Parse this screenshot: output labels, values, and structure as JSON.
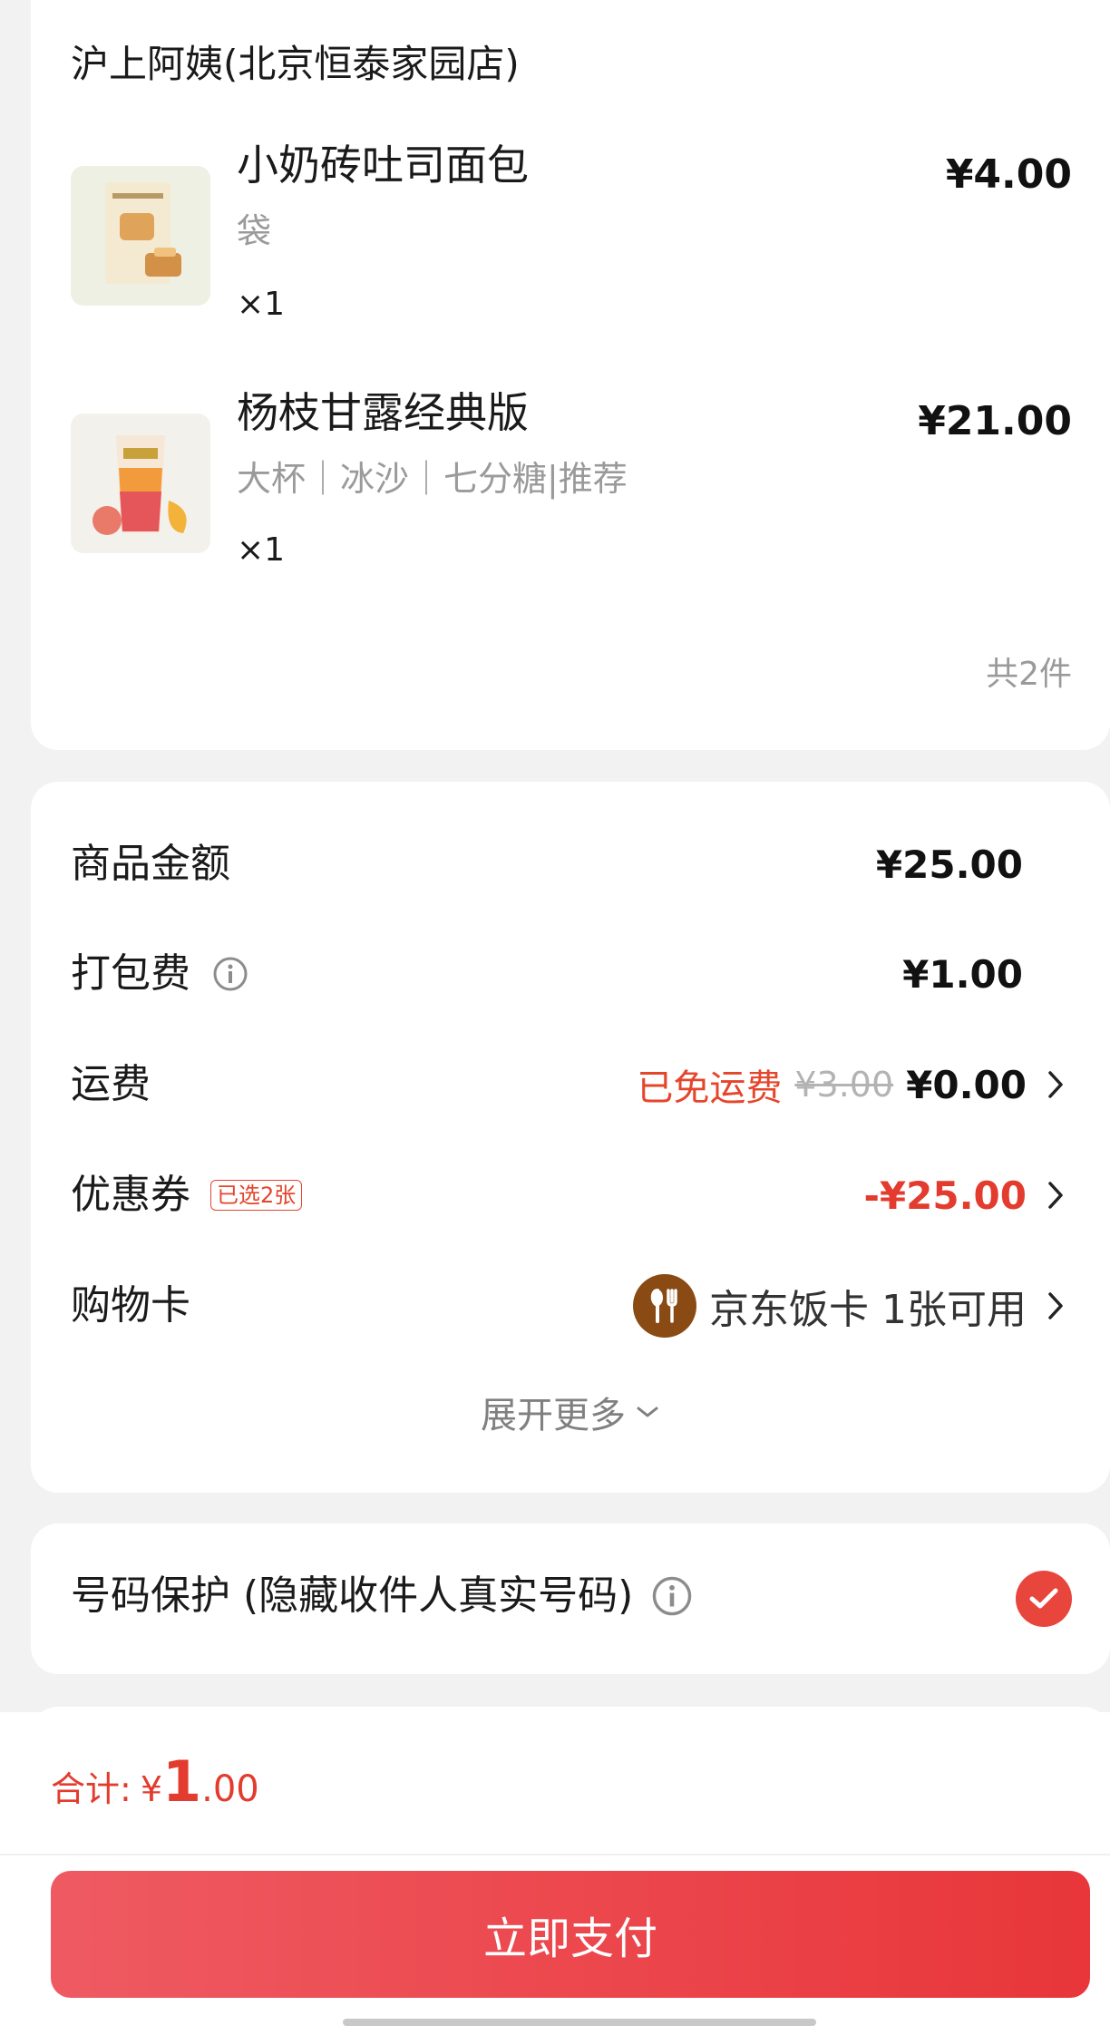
{
  "store": {
    "name": "沪上阿姨(北京恒泰家园店)",
    "items": [
      {
        "title": "小奶砖吐司面包",
        "spec": "袋",
        "qty": "×1",
        "price": "¥4.00"
      },
      {
        "title": "杨枝甘露经典版",
        "spec": "大杯｜冰沙｜七分糖|推荐",
        "qty": "×1",
        "price": "¥21.00"
      }
    ],
    "count": "共2件"
  },
  "fees": {
    "goods": {
      "label": "商品金额",
      "value": "¥25.00"
    },
    "packing": {
      "label": "打包费",
      "value": "¥1.00"
    },
    "shipping": {
      "label": "运费",
      "free_text": "已免运费",
      "original": "¥3.00",
      "value": "¥0.00"
    },
    "coupon": {
      "label": "优惠券",
      "badge": "已选2张",
      "value": "-¥25.00"
    },
    "shopping_card": {
      "label": "购物卡",
      "card_name": "京东饭卡",
      "available": "1张可用"
    },
    "expand_more": "展开更多"
  },
  "privacy": {
    "label": "号码保护 (隐藏收件人真实号码)",
    "checked": true
  },
  "bottom": {
    "total_label": "合计:",
    "currency": "¥",
    "total_int": "1",
    "total_dec": ".00",
    "pay_button": "立即支付"
  },
  "colors": {
    "accent": "#e33b2e",
    "pay_button_start": "#ef5a62",
    "pay_button_end": "#e8363a",
    "card_icon": "#8a4a14"
  }
}
